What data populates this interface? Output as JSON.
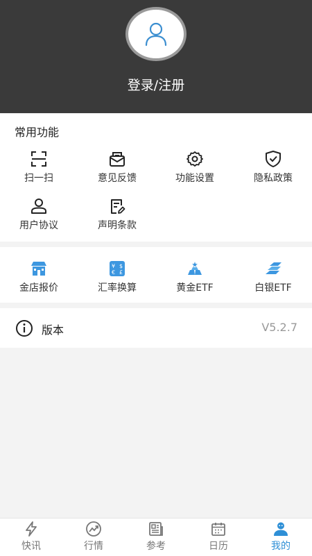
{
  "header": {
    "login_label": "登录/注册"
  },
  "common": {
    "title": "常用功能",
    "items": [
      {
        "label": "扫一扫",
        "icon": "scan-icon"
      },
      {
        "label": "意见反馈",
        "icon": "feedback-icon"
      },
      {
        "label": "功能设置",
        "icon": "gear-icon"
      },
      {
        "label": "隐私政策",
        "icon": "shield-check-icon"
      },
      {
        "label": "用户协议",
        "icon": "user-icon"
      },
      {
        "label": "声明条款",
        "icon": "document-edit-icon"
      }
    ]
  },
  "tools": {
    "items": [
      {
        "label": "金店报价",
        "icon": "gold-shop-icon"
      },
      {
        "label": "汇率换算",
        "icon": "currency-exchange-icon"
      },
      {
        "label": "黄金ETF",
        "icon": "gold-bars-icon"
      },
      {
        "label": "白银ETF",
        "icon": "silver-bars-icon"
      }
    ]
  },
  "version": {
    "label": "版本",
    "value": "V5.2.7"
  },
  "tabs": [
    {
      "label": "快讯",
      "icon": "lightning-icon"
    },
    {
      "label": "行情",
      "icon": "trend-icon"
    },
    {
      "label": "参考",
      "icon": "news-icon"
    },
    {
      "label": "日历",
      "icon": "calendar-icon"
    },
    {
      "label": "我的",
      "icon": "profile-icon"
    }
  ],
  "colors": {
    "header_bg": "#3a3a3a",
    "accent": "#2e8fd6",
    "icon_blue": "#3d97e0"
  }
}
